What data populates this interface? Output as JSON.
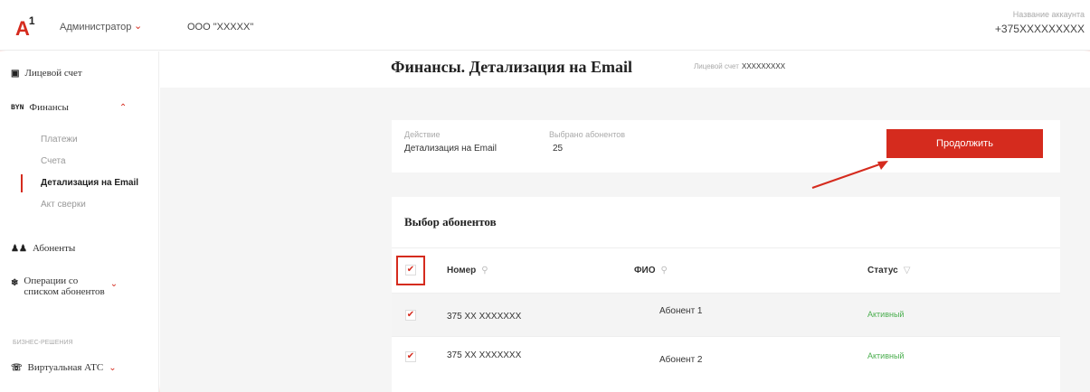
{
  "header": {
    "logo": "A",
    "logo_sup": "1",
    "role": "Администратор",
    "company": "ООО \"XXXXX\"",
    "account_label": "Название аккаунта",
    "account_number": "+375XXXXXXXXX"
  },
  "sidebar": {
    "personal_account": "Лицевой счет",
    "finance_icon": "BYN",
    "finance": "Финансы",
    "sub_items": [
      "Платежи",
      "Счета",
      "Детализация на Email",
      "Акт сверки"
    ],
    "subscribers": "Абоненты",
    "operations_line1": "Операции со",
    "operations_line2": "списком абонентов",
    "section_caption": "бизнес-решения",
    "virtual_pbx": "Виртуальная АТС"
  },
  "main": {
    "title": "Финансы. Детализация на Email",
    "account_label": "Лицевой счет",
    "account_value": "XXXXXXXXX",
    "action_label": "Действие",
    "action_value": "Детализация на Email",
    "selected_label": "Выбрано абонентов",
    "selected_value": "25",
    "continue_button": "Продолжить",
    "table_title": "Выбор абонентов",
    "columns": [
      "Номер",
      "ФИО",
      "Статус"
    ],
    "rows": [
      {
        "number": "375 XX XXXXXXX",
        "name": "Абонент 1",
        "status": "Активный"
      },
      {
        "number": "375 XX XXXXXXX",
        "name": "Абонент 2",
        "status": "Активный"
      }
    ]
  },
  "colors": {
    "accent": "#d52b1e",
    "status_active": "#4caf50"
  }
}
